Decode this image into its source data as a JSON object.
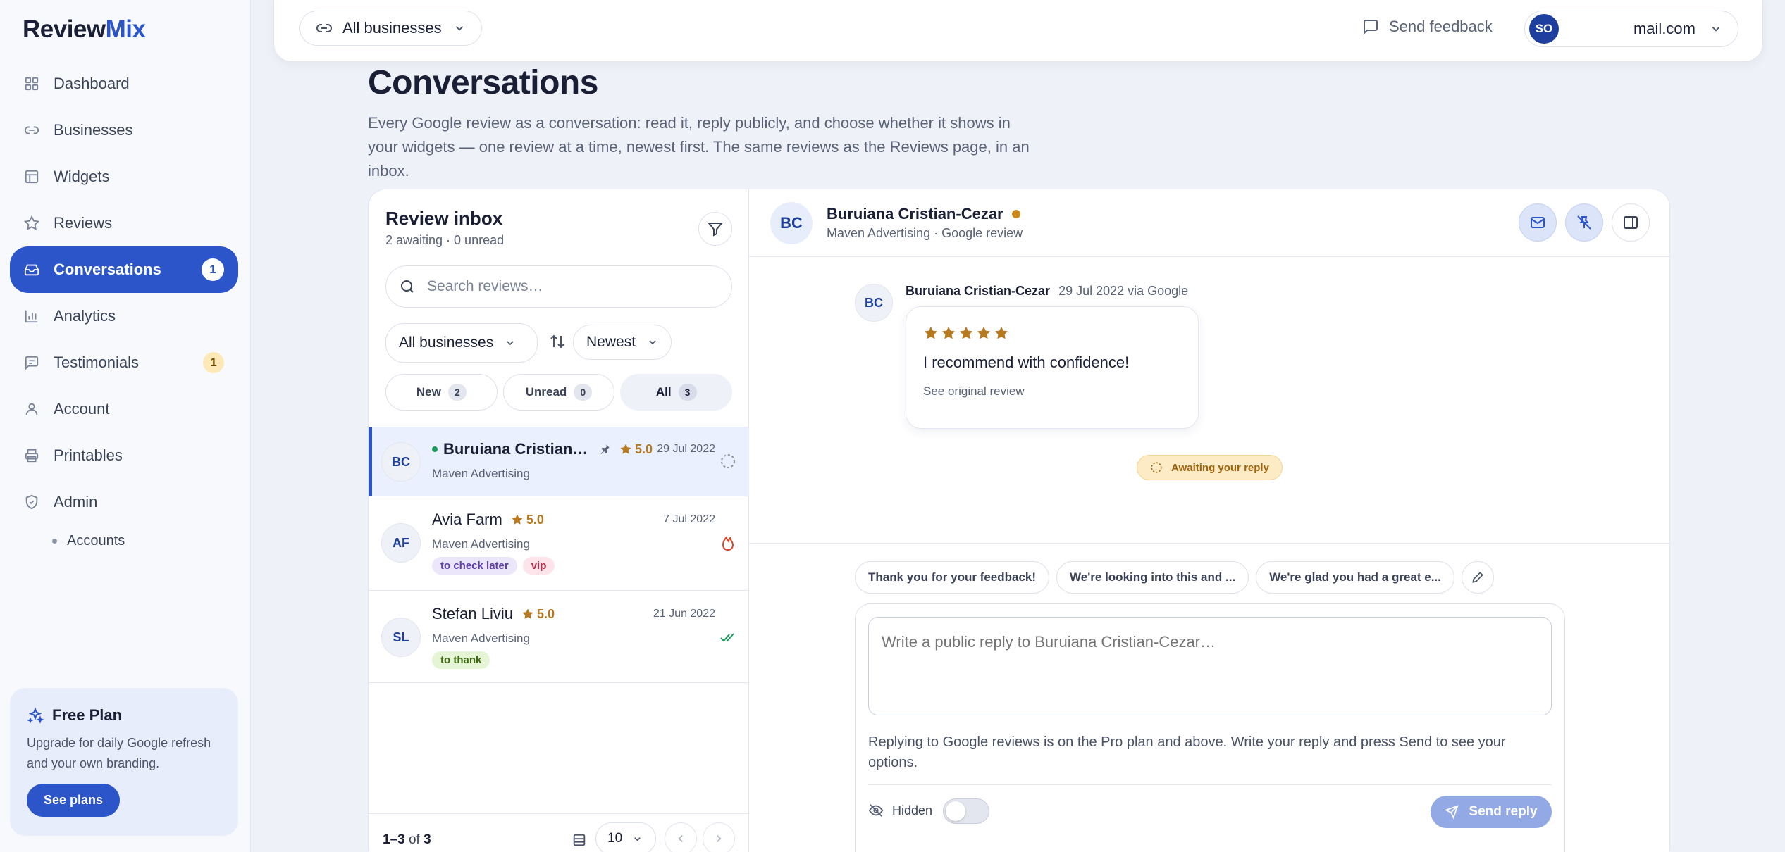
{
  "app": {
    "logo_a": "Review",
    "logo_b": "Mix"
  },
  "sidebar": {
    "items": [
      {
        "label": "Dashboard",
        "icon": "grid-icon"
      },
      {
        "label": "Businesses",
        "icon": "link-icon"
      },
      {
        "label": "Widgets",
        "icon": "layout-icon"
      },
      {
        "label": "Reviews",
        "icon": "star-icon"
      },
      {
        "label": "Conversations",
        "icon": "inbox-icon",
        "badge": "1",
        "active": true
      },
      {
        "label": "Analytics",
        "icon": "bar-chart-icon"
      },
      {
        "label": "Testimonials",
        "icon": "message-square-icon",
        "badge": "1"
      },
      {
        "label": "Account",
        "icon": "user-icon"
      },
      {
        "label": "Printables",
        "icon": "printer-icon"
      },
      {
        "label": "Admin",
        "icon": "shield-icon"
      }
    ],
    "sub_items": [
      {
        "label": "Accounts"
      }
    ],
    "plan": {
      "title": "Free Plan",
      "text": "Upgrade for daily Google refresh and your own branding.",
      "button": "See plans"
    }
  },
  "topbar": {
    "business_select": "All businesses",
    "feedback": "Send feedback",
    "user_initials": "SO",
    "user_email": "mail.com"
  },
  "page": {
    "title": "Conversations",
    "description": "Every Google review as a conversation: read it, reply publicly, and choose whether it shows in your widgets — one review at a time, newest first. The same reviews as the Reviews page, in an inbox."
  },
  "inbox": {
    "title": "Review inbox",
    "subtitle": "2 awaiting · 0 unread",
    "search_placeholder": "Search reviews…",
    "business_filter": "All businesses",
    "sort": "Newest",
    "tabs": [
      {
        "label": "New",
        "count": "2"
      },
      {
        "label": "Unread",
        "count": "0"
      },
      {
        "label": "All",
        "count": "3",
        "active": true
      }
    ],
    "rows": [
      {
        "initials": "BC",
        "name": "Buruiana Cristian-Cezar",
        "rating": "5.0",
        "date": "29 Jul 2022",
        "business": "Maven Advertising",
        "tags": [],
        "status": "awaiting"
      },
      {
        "initials": "AF",
        "name": "Avia Farm",
        "rating": "5.0",
        "date": "7 Jul 2022",
        "business": "Maven Advertising",
        "tags": [
          "to check later",
          "vip"
        ],
        "status": "hot"
      },
      {
        "initials": "SL",
        "name": "Stefan Liviu",
        "rating": "5.0",
        "date": "21 Jun 2022",
        "business": "Maven Advertising",
        "tags": [
          "to thank"
        ],
        "status": "replied"
      }
    ],
    "footer": {
      "range": "1–3",
      "of": "of",
      "total": "3",
      "per_page": "10"
    }
  },
  "thread": {
    "initials": "BC",
    "name": "Buruiana Cristian-Cezar",
    "subtitle": "Maven Advertising · Google review",
    "message": {
      "author": "Buruiana Cristian-Cezar",
      "meta": "29 Jul 2022 via Google",
      "rating": 5,
      "text": "I recommend with confidence!",
      "link": "See original review"
    },
    "status": "Awaiting your reply",
    "quick_replies": [
      "Thank you for your feedback!",
      "We're looking into this and ...",
      "We're glad you had a great e..."
    ],
    "reply_placeholder": "Write a public reply to Buruiana Cristian-Cezar…",
    "note": "Replying to Google reviews is on the Pro plan and above. Write your reply and press Send to see your options.",
    "hidden_label": "Hidden",
    "send_label": "Send reply"
  },
  "colors": {
    "accent": "#2b55c9",
    "star": "#b7791f",
    "awaiting_bg": "#fdebc6"
  }
}
